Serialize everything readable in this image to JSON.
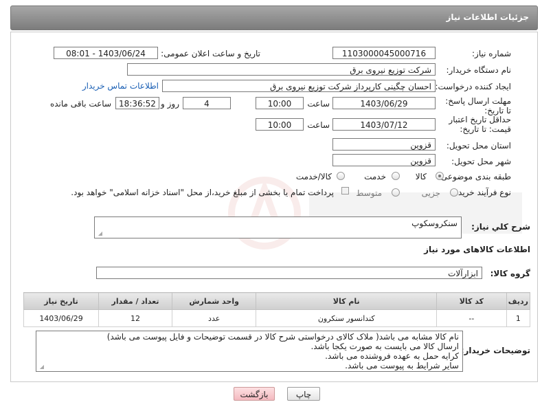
{
  "header": {
    "title": "جزئیات اطلاعات نیاز"
  },
  "form": {
    "need_number": {
      "label": "شماره نیاز:",
      "value": "1103000045000716"
    },
    "announce": {
      "label": "تاریخ و ساعت اعلان عمومی:",
      "value": "1403/06/24 - 08:01"
    },
    "buyer": {
      "label": "نام دستگاه خریدار:",
      "value": "شرکت توزیع نیروی برق"
    },
    "creator": {
      "label": "ایجاد کننده درخواست:",
      "value": "احسان چگینی کارپرداز شرکت توزیع نیروی برق",
      "contact_link": "اطلاعات تماس خریدار"
    },
    "reply_deadline": {
      "label": "مهلت ارسال پاسخ: تا تاریخ:",
      "date": "1403/06/29",
      "time_label": "ساعت",
      "time": "10:00",
      "days": "4",
      "days_label": "روز و",
      "remaining": "18:36:52",
      "remaining_label": "ساعت باقی مانده"
    },
    "price_validity": {
      "label": "حداقل تاریخ اعتبار قیمت: تا تاریخ:",
      "date": "1403/07/12",
      "time_label": "ساعت",
      "time": "10:00"
    },
    "province": {
      "label": "استان محل تحویل:",
      "value": "قزوین"
    },
    "city": {
      "label": "شهر محل تحویل:",
      "value": "قزوین"
    },
    "category": {
      "label": "طبقه بندی موضوعی:",
      "options": [
        "کالا",
        "خدمت",
        "کالا/خدمت"
      ]
    },
    "process": {
      "label": "نوع فرآیند خرید :",
      "options": [
        "جزیی",
        "متوسط"
      ],
      "payment_note": "پرداخت تمام یا بخشی از مبلغ خرید،از محل \"اسناد خزانه اسلامی\" خواهد بود."
    }
  },
  "description": {
    "label": "شرح كلي نياز:",
    "value": "سنکروسکوپ"
  },
  "goods_section": {
    "title": "اطلاعات کالاهای مورد نیاز"
  },
  "goods_group": {
    "label": "گروه کالا:",
    "value": "ابزارآلات"
  },
  "table": {
    "headers": [
      "ردیف",
      "کد کالا",
      "نام کالا",
      "واحد شمارش",
      "تعداد / مقدار",
      "تاریخ نیاز"
    ],
    "rows": [
      [
        "1",
        "--",
        "کندانسور سنکرون",
        "عدد",
        "12",
        "1403/06/29"
      ]
    ]
  },
  "buyer_notes": {
    "label": "توضیحات خریدار:",
    "lines": [
      "نام کالا مشابه می باشد( ملاک کالای درخواستی شرح کالا در قسمت توضیحات و فایل پیوست می باشد)",
      "ارسال کالا می بایست به صورت یکجا باشد.",
      "کرایه حمل به عهده فروشنده می باشد.",
      "سایر شرایط به پیوست می باشد."
    ]
  },
  "buttons": {
    "print": "چاپ",
    "back": "بازگشت"
  }
}
